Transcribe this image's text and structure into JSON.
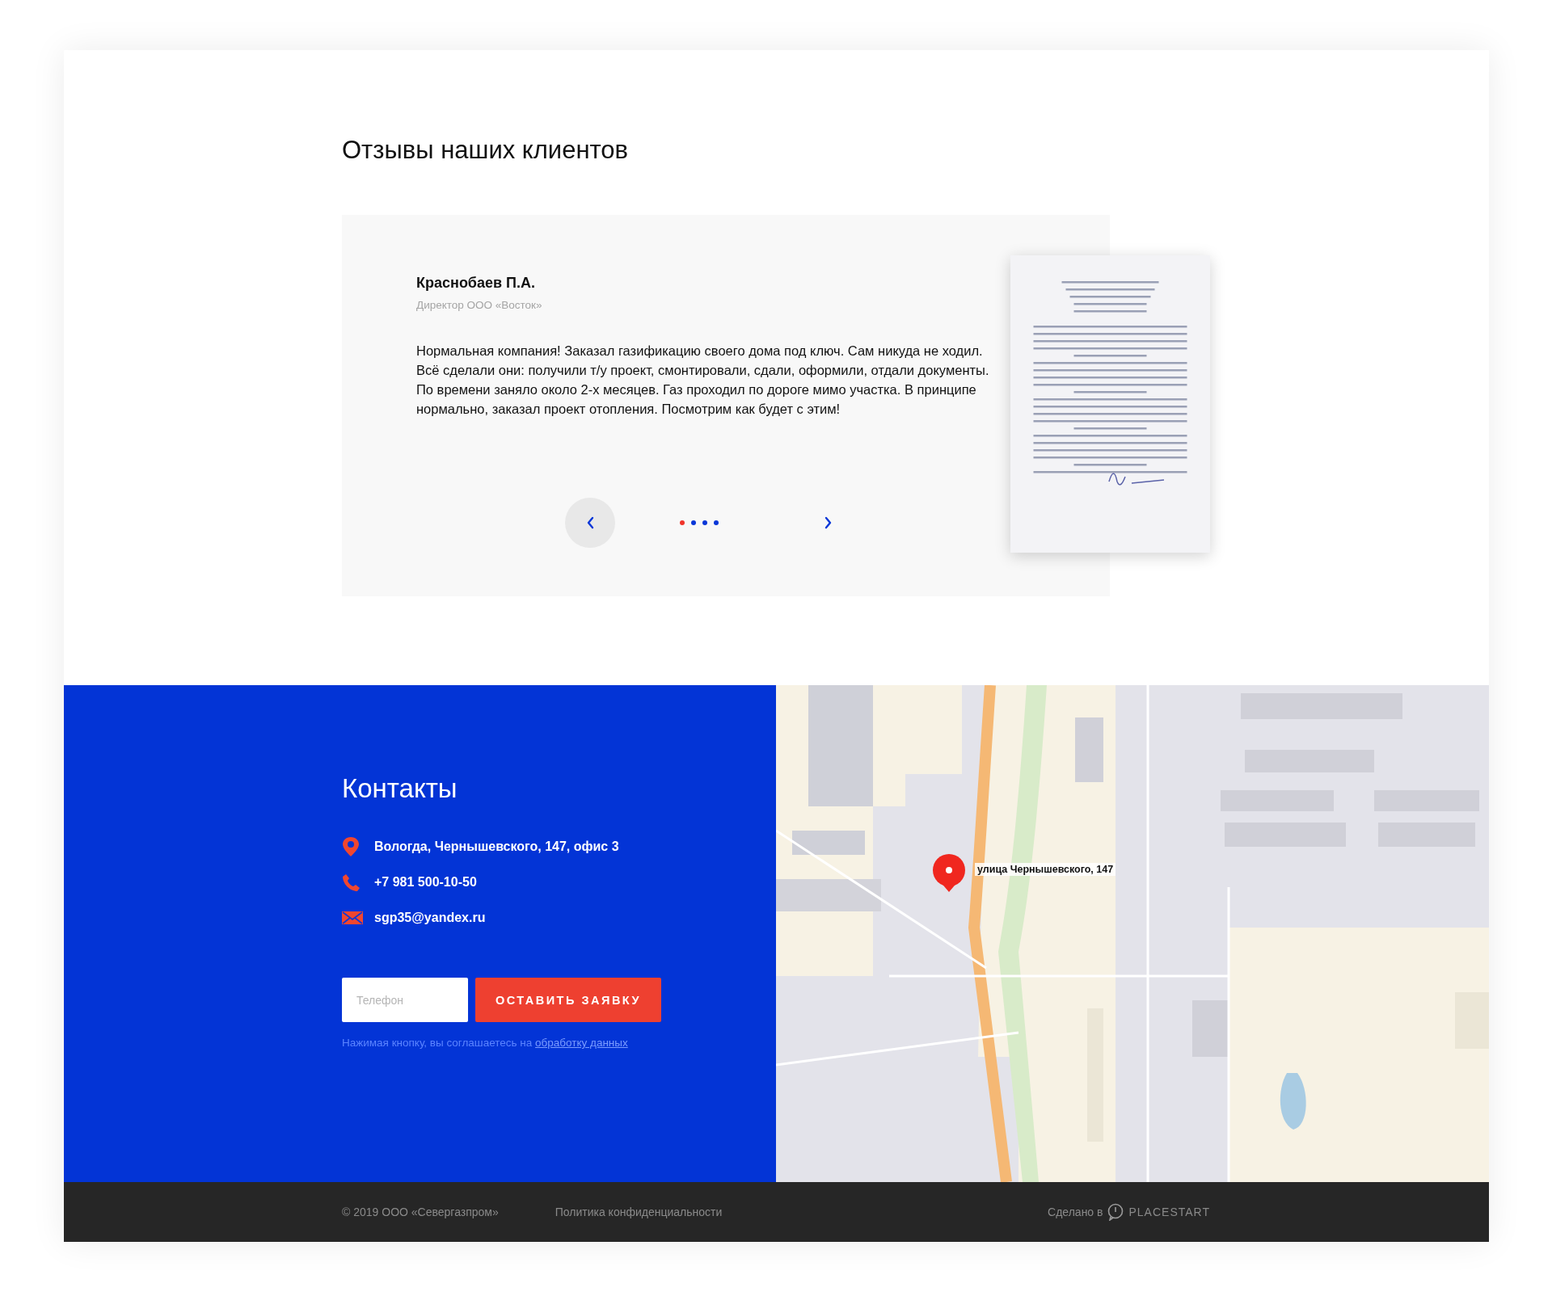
{
  "reviews": {
    "title": "Отзывы наших клиентов",
    "review": {
      "author": "Краснобаев П.А.",
      "position": "Директор ООО «Восток»",
      "text": "Нормальная компания! Заказал газификацию своего дома под ключ. Сам никуда не ходил. Всё сделали они: получили т/у проект, смонтировали, сдали, оформили, отдали документы. По времени заняло около 2-х месяцев. Газ проходил по дороге мимо участка. В принципе нормально, заказал проект отопления. Посмотрим как будет с этим!"
    },
    "dots": [
      {
        "selected": true
      },
      {
        "selected": false
      },
      {
        "selected": false
      },
      {
        "selected": false
      }
    ]
  },
  "contacts": {
    "title": "Контакты",
    "items": [
      {
        "kind": "address",
        "text": "Вологда, Чернышевского, 147, офис 3"
      },
      {
        "kind": "phone",
        "text": "+7 981 500-10-50"
      },
      {
        "kind": "email",
        "text": "sgp35@yandex.ru"
      }
    ],
    "phone_field": {
      "placeholder": "Телефон"
    },
    "submit_button": "ОСТАВИТЬ ЗАЯВКУ",
    "consent": {
      "text": "Нажимая кнопку, вы соглашаетесь на",
      "link": "обработку данных"
    }
  },
  "map": {
    "pin_label": "улица Чернышевского, 147"
  },
  "footer": {
    "copyright": "© 2019 ООО «Севергазпром»",
    "privacy_link": "Политика конфиденциальности",
    "made_by": "Сделано в",
    "brand": "PLACESTART"
  }
}
